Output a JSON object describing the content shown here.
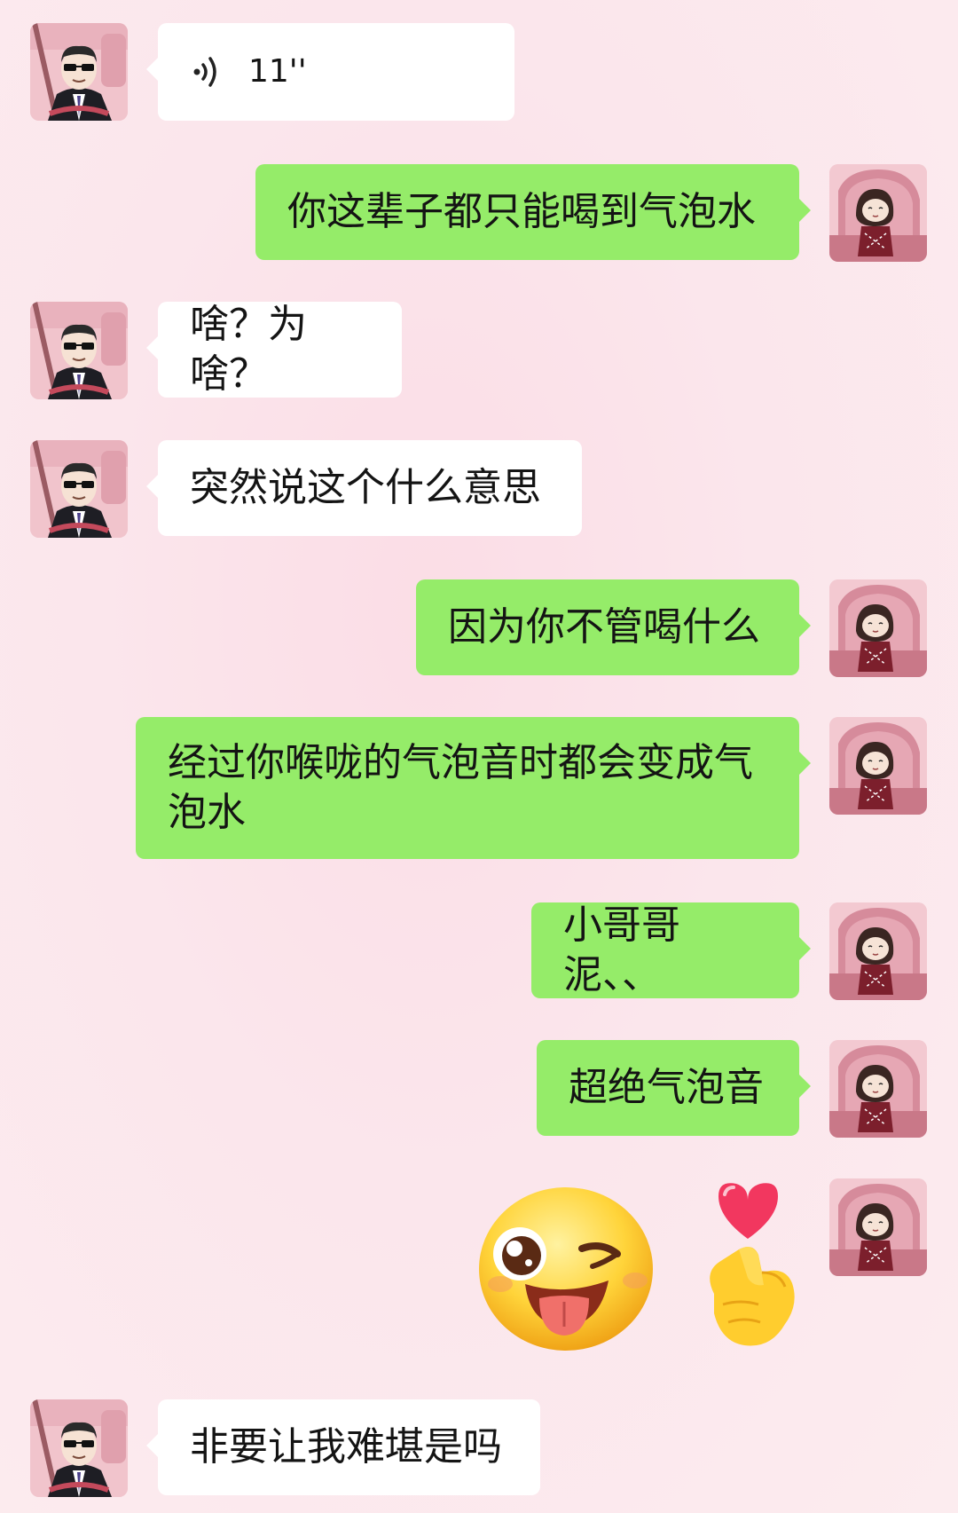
{
  "messages": [
    {
      "id": "m1",
      "side": "in",
      "type": "voice",
      "duration": "11''"
    },
    {
      "id": "m2",
      "side": "out",
      "type": "text",
      "text": "你这辈子都只能喝到气泡水"
    },
    {
      "id": "m3",
      "side": "in",
      "type": "text",
      "text": "啥？为啥？"
    },
    {
      "id": "m4",
      "side": "in",
      "type": "text",
      "text": "突然说这个什么意思"
    },
    {
      "id": "m5",
      "side": "out",
      "type": "text",
      "text": "因为你不管喝什么"
    },
    {
      "id": "m6",
      "side": "out",
      "type": "text",
      "text": "经过你喉咙的气泡音时都会变成气泡水"
    },
    {
      "id": "m7",
      "side": "out",
      "type": "text",
      "text": "小哥哥泥、、"
    },
    {
      "id": "m8",
      "side": "out",
      "type": "text",
      "text": "超绝气泡音"
    },
    {
      "id": "m9",
      "side": "out",
      "type": "sticker",
      "stickers": [
        "wink-tongue-emoji",
        "heart-finger-emoji"
      ]
    },
    {
      "id": "m10",
      "side": "in",
      "type": "text",
      "text": "非要让我难堪是吗"
    }
  ],
  "colors": {
    "outgoing_bubble": "#95ec69",
    "incoming_bubble": "#ffffff",
    "background": "#fbe6ec"
  },
  "avatars": {
    "incoming": "man-with-sunglasses-driving-avatar",
    "outgoing": "cartoon-girl-in-pink-car-avatar"
  }
}
